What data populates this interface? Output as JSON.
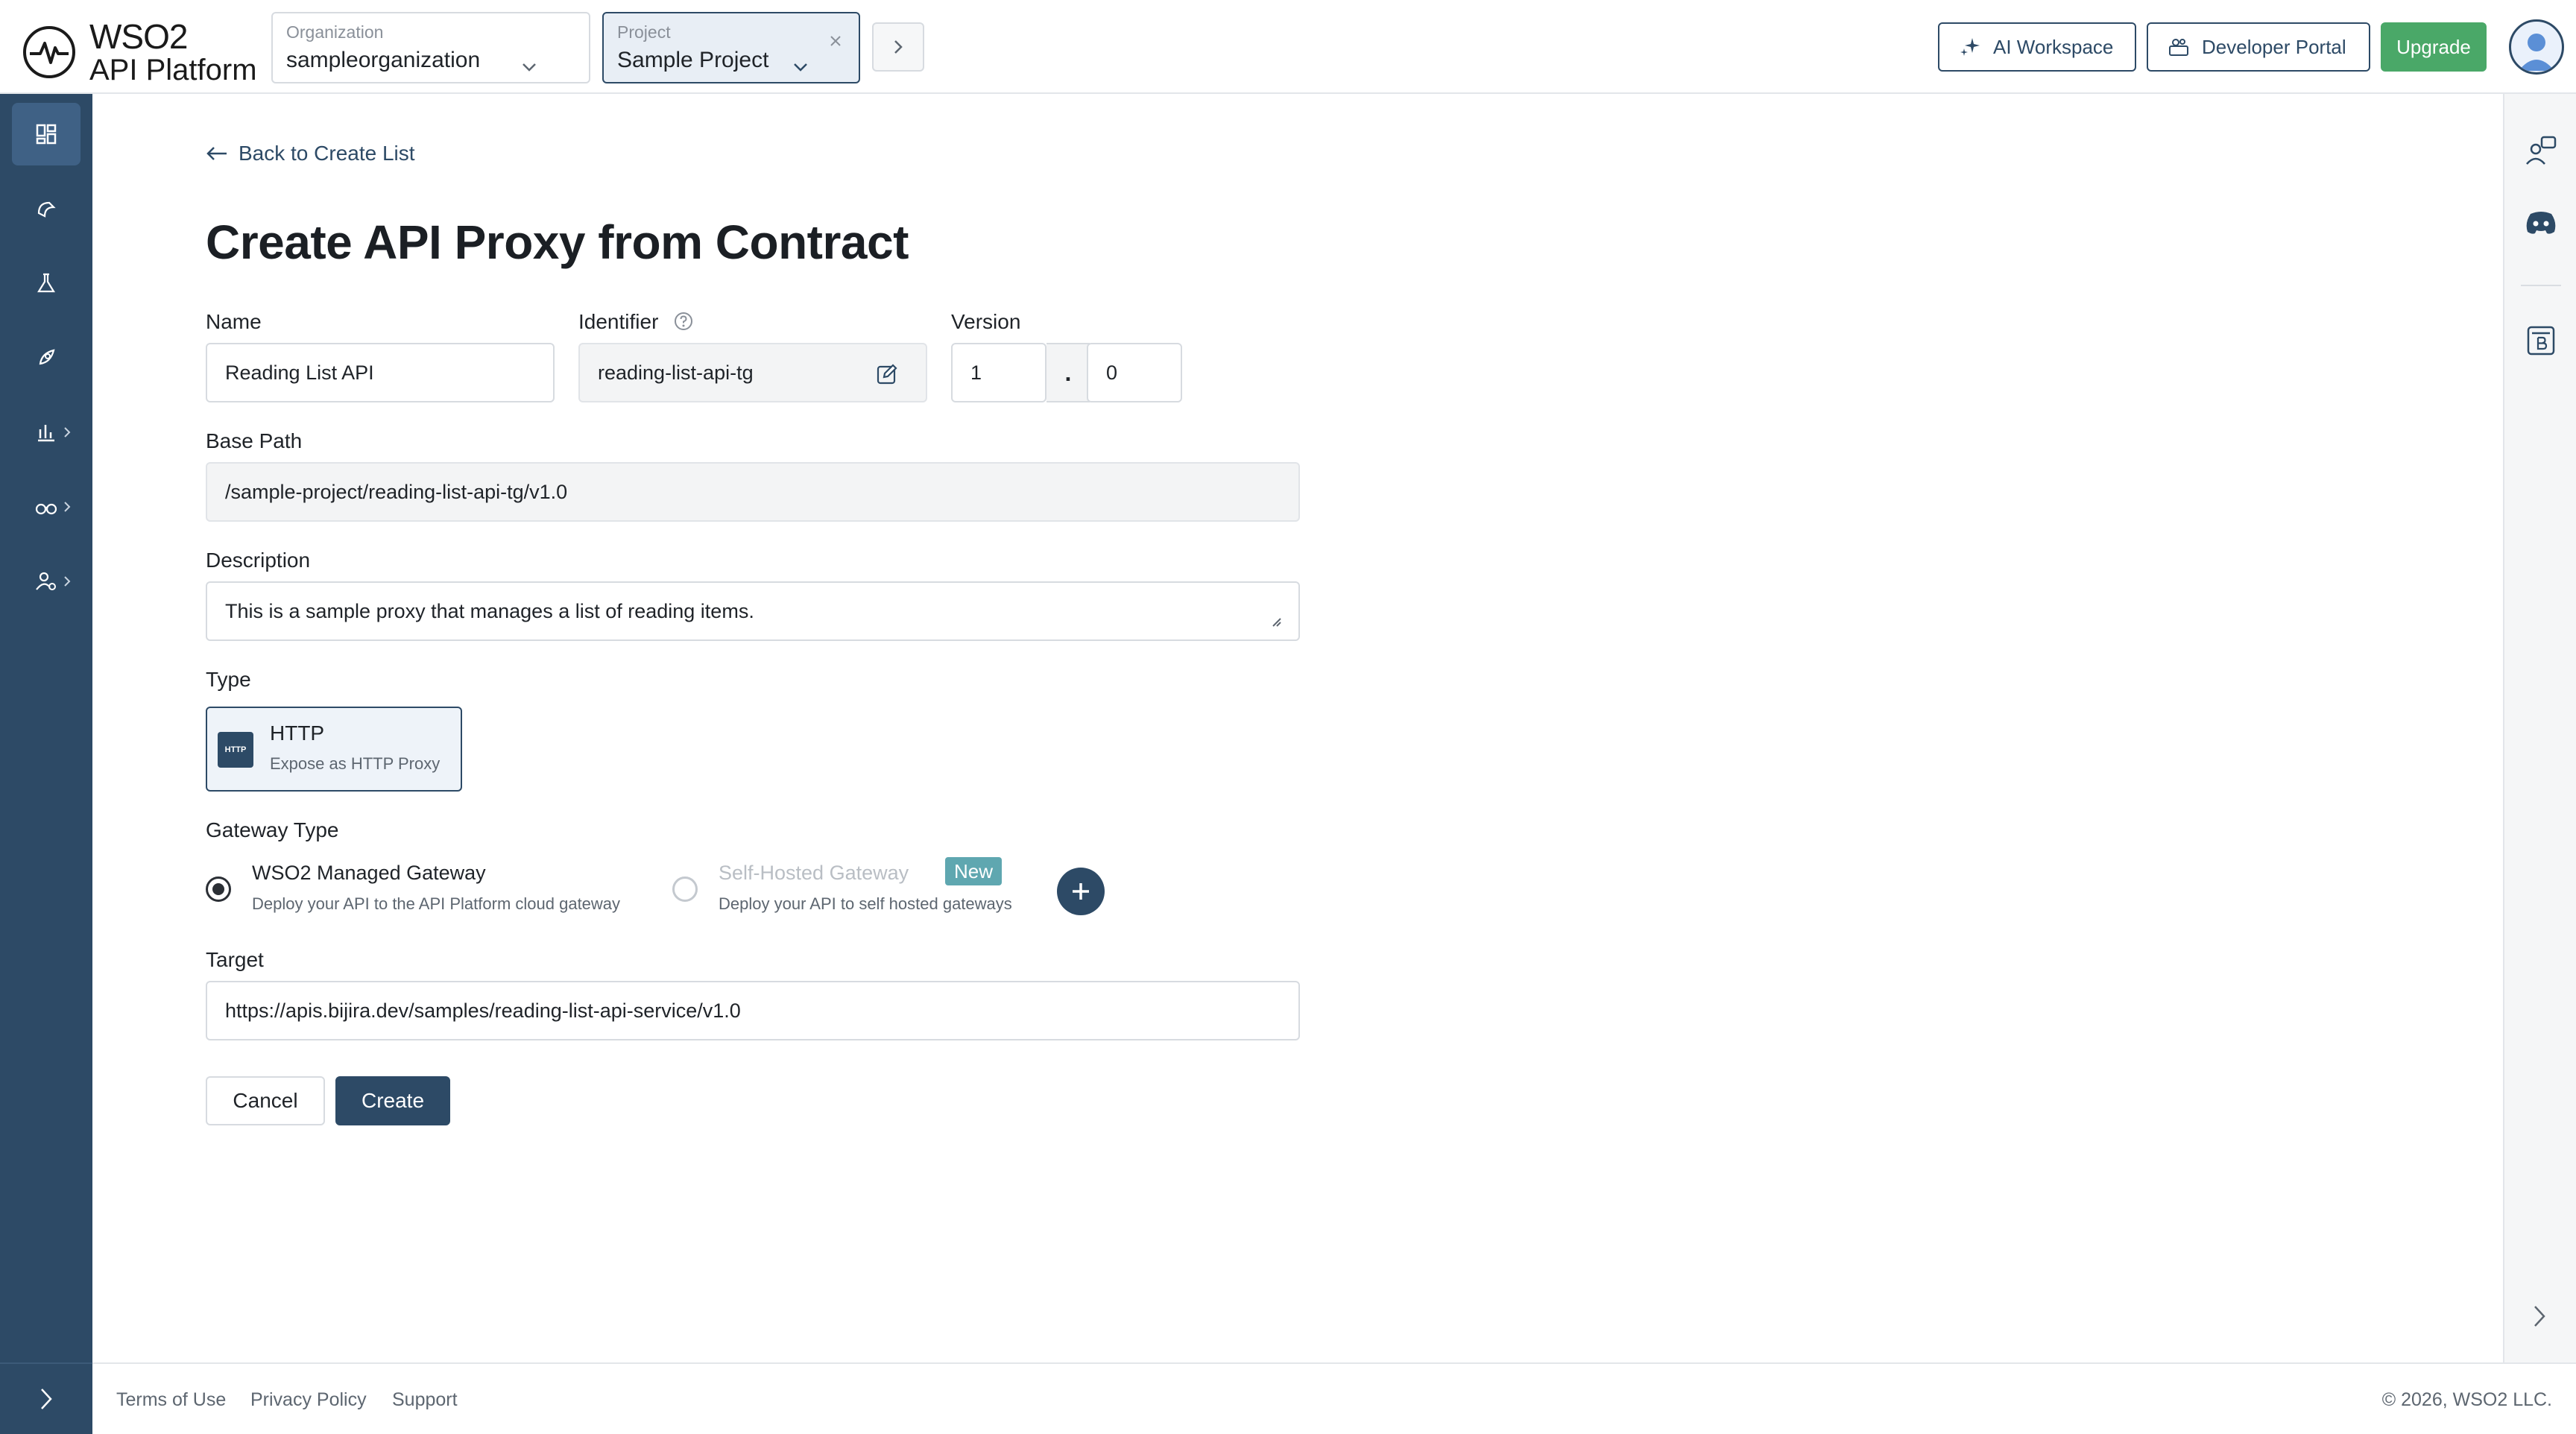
{
  "brand": {
    "line1": "WSO2",
    "line2": "API Platform"
  },
  "organization": {
    "caption": "Organization",
    "value": "sampleorganization"
  },
  "project": {
    "caption": "Project",
    "value": "Sample Project"
  },
  "header_buttons": {
    "ai": "AI Workspace",
    "dev_portal": "Developer Portal",
    "upgrade": "Upgrade"
  },
  "page": {
    "back_link": "Back to Create List",
    "title": "Create API Proxy from Contract"
  },
  "form": {
    "name": {
      "label": "Name",
      "value": "Reading List API"
    },
    "identifier": {
      "label": "Identifier",
      "value": "reading-list-api-tg"
    },
    "version": {
      "label": "Version",
      "major": "1",
      "separator": ".",
      "minor": "0"
    },
    "base_path": {
      "label": "Base Path",
      "value": "/sample-project/reading-list-api-tg/v1.0"
    },
    "description": {
      "label": "Description",
      "value": "This is a sample proxy that manages a list of reading items."
    },
    "type": {
      "label": "Type",
      "icon_text": "HTTP",
      "title": "HTTP",
      "subtitle": "Expose as HTTP Proxy"
    },
    "gateway": {
      "label": "Gateway Type",
      "managed": {
        "title": "WSO2 Managed Gateway",
        "subtitle": "Deploy your API to the API Platform cloud gateway",
        "selected": true
      },
      "self_hosted": {
        "title": "Self-Hosted Gateway",
        "badge": "New",
        "subtitle": "Deploy your API to self hosted gateways",
        "selected": false
      }
    },
    "target": {
      "label": "Target",
      "value": "https://apis.bijira.dev/samples/reading-list-api-service/v1.0"
    },
    "buttons": {
      "cancel": "Cancel",
      "create": "Create"
    }
  },
  "footer": {
    "links": [
      "Terms of Use",
      "Privacy Policy",
      "Support"
    ],
    "copyright": "© 2026, WSO2 LLC."
  },
  "colors": {
    "primary": "#2d4a66",
    "upgrade": "#4aa868",
    "badge": "#5fa7b0"
  }
}
